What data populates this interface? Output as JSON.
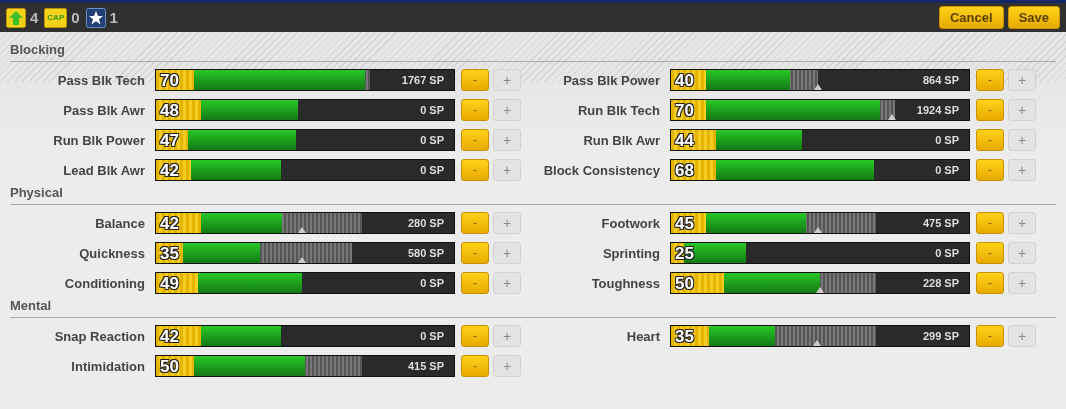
{
  "header": {
    "counters": [
      {
        "kind": "upgrade",
        "count": "4"
      },
      {
        "kind": "cap",
        "icon_text": "CAP",
        "count": "0"
      },
      {
        "kind": "star",
        "count": "1"
      }
    ],
    "buttons": [
      {
        "label": "Cancel"
      },
      {
        "label": "Save"
      }
    ]
  },
  "sections": [
    {
      "title": "Blocking",
      "stats": [
        {
          "name": "Pass Blk Tech",
          "value": "70",
          "sp": "1767 SP",
          "segments": [
            {
              "kind": "cap",
              "level": 0.717
            },
            {
              "kind": "current",
              "level": 0.703
            },
            {
              "kind": "base",
              "level": 0.127
            }
          ],
          "minus": {
            "label": "-",
            "disabled": false
          },
          "plus": {
            "label": "+",
            "disabled": true
          }
        },
        {
          "name": "Pass Blk Power",
          "value": "40",
          "sp": "864 SP",
          "segments": [
            {
              "kind": "cap",
              "level": 0.493
            },
            {
              "kind": "current",
              "level": 0.4
            },
            {
              "kind": "base",
              "level": 0.117
            },
            {
              "kind": "marker",
              "level": 0.493
            }
          ],
          "minus": {
            "label": "-",
            "disabled": false
          },
          "plus": {
            "label": "+",
            "disabled": true
          }
        },
        {
          "name": "Pass Blk Awr",
          "value": "48",
          "sp": "0 SP",
          "segments": [
            {
              "kind": "current",
              "level": 0.477
            },
            {
              "kind": "base",
              "level": 0.15
            }
          ],
          "minus": {
            "label": "-",
            "disabled": false
          },
          "plus": {
            "label": "+",
            "disabled": true
          }
        },
        {
          "name": "Run Blk Tech",
          "value": "70",
          "sp": "1924 SP",
          "segments": [
            {
              "kind": "cap",
              "level": 0.75
            },
            {
              "kind": "current",
              "level": 0.7
            },
            {
              "kind": "base",
              "level": 0.117
            },
            {
              "kind": "marker",
              "level": 0.74
            }
          ],
          "minus": {
            "label": "-",
            "disabled": false
          },
          "plus": {
            "label": "+",
            "disabled": true
          }
        },
        {
          "name": "Run Blk Power",
          "value": "47",
          "sp": "0 SP",
          "segments": [
            {
              "kind": "current",
              "level": 0.47
            },
            {
              "kind": "base",
              "level": 0.107
            }
          ],
          "minus": {
            "label": "-",
            "disabled": false
          },
          "plus": {
            "label": "+",
            "disabled": true
          }
        },
        {
          "name": "Run Blk Awr",
          "value": "44",
          "sp": "0 SP",
          "segments": [
            {
              "kind": "current",
              "level": 0.44
            },
            {
              "kind": "base",
              "level": 0.15
            }
          ],
          "minus": {
            "label": "-",
            "disabled": false
          },
          "plus": {
            "label": "+",
            "disabled": true
          }
        },
        {
          "name": "Lead Blk Awr",
          "value": "42",
          "sp": "0 SP",
          "segments": [
            {
              "kind": "current",
              "level": 0.42
            },
            {
              "kind": "base",
              "level": 0.117
            }
          ],
          "minus": {
            "label": "-",
            "disabled": false
          },
          "plus": {
            "label": "+",
            "disabled": true
          }
        },
        {
          "name": "Block Consistency",
          "value": "68",
          "sp": "0 SP",
          "segments": [
            {
              "kind": "current",
              "level": 0.68
            },
            {
              "kind": "base",
              "level": 0.15
            }
          ],
          "minus": {
            "label": "-",
            "disabled": false
          },
          "plus": {
            "label": "+",
            "disabled": true
          }
        }
      ]
    },
    {
      "title": "Physical",
      "stats": [
        {
          "name": "Balance",
          "value": "42",
          "sp": "280 SP",
          "segments": [
            {
              "kind": "cap",
              "level": 0.69
            },
            {
              "kind": "current",
              "level": 0.423
            },
            {
              "kind": "base",
              "level": 0.15
            },
            {
              "kind": "marker",
              "level": 0.49
            }
          ],
          "minus": {
            "label": "-",
            "disabled": false
          },
          "plus": {
            "label": "+",
            "disabled": true
          }
        },
        {
          "name": "Footwork",
          "value": "45",
          "sp": "475 SP",
          "segments": [
            {
              "kind": "cap",
              "level": 0.687
            },
            {
              "kind": "current",
              "level": 0.453
            },
            {
              "kind": "base",
              "level": 0.117
            },
            {
              "kind": "marker",
              "level": 0.493
            }
          ],
          "minus": {
            "label": "-",
            "disabled": false
          },
          "plus": {
            "label": "+",
            "disabled": true
          }
        },
        {
          "name": "Quickness",
          "value": "35",
          "sp": "580 SP",
          "segments": [
            {
              "kind": "cap",
              "level": 0.657
            },
            {
              "kind": "current",
              "level": 0.35
            },
            {
              "kind": "base",
              "level": 0.09
            },
            {
              "kind": "marker",
              "level": 0.49
            }
          ],
          "minus": {
            "label": "-",
            "disabled": false
          },
          "plus": {
            "label": "+",
            "disabled": true
          }
        },
        {
          "name": "Sprinting",
          "value": "25",
          "sp": "0 SP",
          "segments": [
            {
              "kind": "current",
              "level": 0.25
            },
            {
              "kind": "base",
              "level": 0.043
            }
          ],
          "minus": {
            "label": "-",
            "disabled": false
          },
          "plus": {
            "label": "+",
            "disabled": true
          }
        },
        {
          "name": "Conditioning",
          "value": "49",
          "sp": "0 SP",
          "segments": [
            {
              "kind": "current",
              "level": 0.49
            },
            {
              "kind": "base",
              "level": 0.14
            }
          ],
          "minus": {
            "label": "-",
            "disabled": false
          },
          "plus": {
            "label": "+",
            "disabled": true
          }
        },
        {
          "name": "Toughness",
          "value": "50",
          "sp": "228 SP",
          "segments": [
            {
              "kind": "cap",
              "level": 0.687
            },
            {
              "kind": "current",
              "level": 0.5
            },
            {
              "kind": "base",
              "level": 0.177
            },
            {
              "kind": "marker",
              "level": 0.5
            }
          ],
          "minus": {
            "label": "-",
            "disabled": false
          },
          "plus": {
            "label": "+",
            "disabled": true
          }
        }
      ]
    },
    {
      "title": "Mental",
      "stats": [
        {
          "name": "Snap Reaction",
          "value": "42",
          "sp": "0 SP",
          "segments": [
            {
              "kind": "current",
              "level": 0.42
            },
            {
              "kind": "base",
              "level": 0.15
            }
          ],
          "minus": {
            "label": "-",
            "disabled": false
          },
          "plus": {
            "label": "+",
            "disabled": true
          }
        },
        {
          "name": "Heart",
          "value": "35",
          "sp": "299 SP",
          "segments": [
            {
              "kind": "cap",
              "level": 0.687
            },
            {
              "kind": "current",
              "level": 0.35
            },
            {
              "kind": "base",
              "level": 0.127
            },
            {
              "kind": "marker",
              "level": 0.49
            }
          ],
          "minus": {
            "label": "-",
            "disabled": false
          },
          "plus": {
            "label": "+",
            "disabled": true
          }
        },
        {
          "name": "Intimidation",
          "value": "50",
          "sp": "415 SP",
          "segments": [
            {
              "kind": "cap",
              "level": 0.69
            },
            {
              "kind": "current",
              "level": 0.5
            },
            {
              "kind": "base",
              "level": 0.127
            }
          ],
          "minus": {
            "label": "-",
            "disabled": false
          },
          "plus": {
            "label": "+",
            "disabled": true
          }
        }
      ]
    }
  ]
}
